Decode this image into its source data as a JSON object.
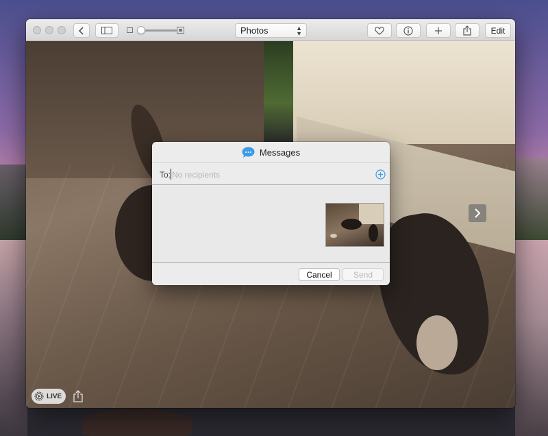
{
  "toolbar": {
    "view_select_label": "Photos",
    "edit_label": "Edit",
    "icons": {
      "back": "chevron-left-icon",
      "sidebar": "sidebar-icon",
      "favorite": "heart-icon",
      "info": "info-icon",
      "add": "plus-icon",
      "share": "share-icon"
    }
  },
  "photo_viewer": {
    "live_badge_label": "LIVE",
    "next_arrow": "chevron-right-icon"
  },
  "messages_dialog": {
    "title": "Messages",
    "to_label": "To:",
    "recipients_placeholder": "No recipients",
    "recipients_value": "",
    "cancel_label": "Cancel",
    "send_label": "Send",
    "accent_color": "#3d9be9"
  }
}
